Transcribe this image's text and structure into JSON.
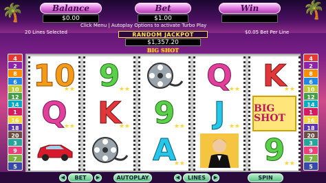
{
  "header": {
    "balance_label": "Balance",
    "balance_value": "$0.00",
    "bet_label": "Bet",
    "bet_value": "$1.00",
    "win_label": "Win",
    "win_value": "",
    "lines_selected": "20 Lines Selected",
    "menu_hint": "Click Menu | Autoplay Options to activate Turbo Play",
    "bet_per_line": "$0.05 Bet Per Line"
  },
  "jackpot": {
    "label": "RANDOM JACKPOT",
    "value": "$1,357.20"
  },
  "logo": "BIG SHOT",
  "reels": [
    [
      "10",
      "Q",
      "car"
    ],
    [
      "9",
      "K",
      "film-reel"
    ],
    [
      "film-reel",
      "9",
      "A"
    ],
    [
      "Q",
      "J",
      "star-man"
    ],
    [
      "K",
      "BIG SHOT",
      "9"
    ]
  ],
  "lines_left": [
    "4",
    "2",
    "8",
    "6",
    "10",
    "12",
    "14",
    "1",
    "16",
    "18",
    "20",
    "3",
    "9",
    "7",
    "5"
  ],
  "lines_right": [
    "4",
    "2",
    "8",
    "6",
    "10",
    "12",
    "14",
    "1",
    "16",
    "18",
    "20",
    "3",
    "9",
    "7",
    "5"
  ],
  "controls": {
    "bet": "BET",
    "autoplay": "AUTOPLAY",
    "lines": "LINES",
    "spin": "SPIN"
  },
  "colors": {
    "pill": "#e07ae0",
    "gold": "#ffd43a",
    "cyan": "#26c6e8"
  }
}
